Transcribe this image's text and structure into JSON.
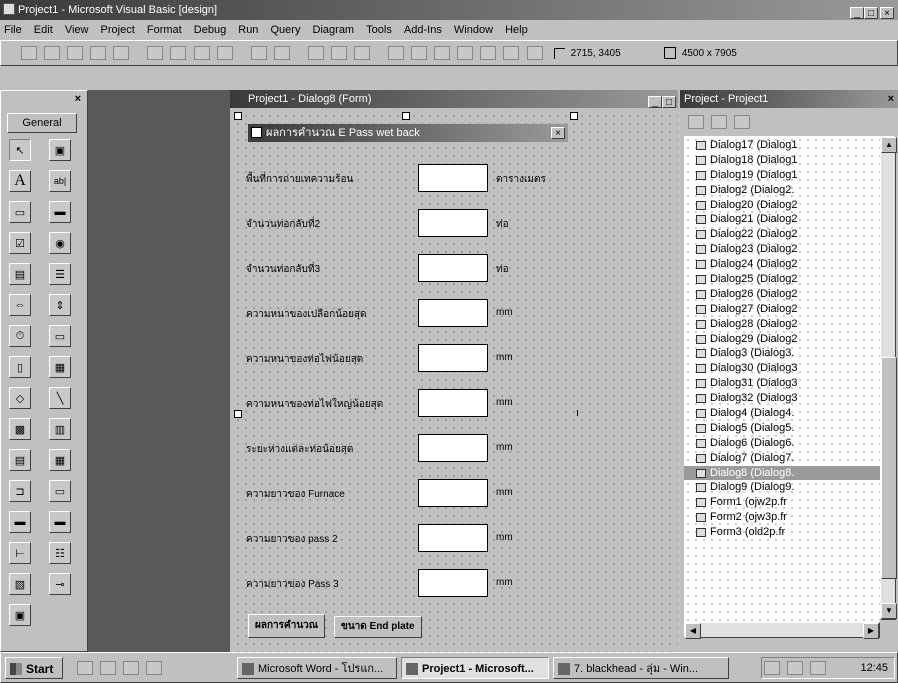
{
  "main_window": {
    "title": "Project1 - Microsoft Visual Basic [design]",
    "controls": [
      "_",
      "□",
      "×"
    ]
  },
  "menu": [
    "File",
    "Edit",
    "View",
    "Project",
    "Format",
    "Debug",
    "Run",
    "Query",
    "Diagram",
    "Tools",
    "Add-Ins",
    "Window",
    "Help"
  ],
  "toolbar": {
    "position": "2715, 3405",
    "size": "4500 x 7905"
  },
  "toolbox": {
    "title": "General",
    "close": "×"
  },
  "form_window": {
    "title": "Project1 - Dialog8 (Form)"
  },
  "dialog": {
    "title": "ผลการคำนวณ E Pass wet back",
    "close": "×",
    "rows": [
      {
        "label": "พื้นที่การถ่ายเทความร้อน",
        "unit": "ตารางเมตร"
      },
      {
        "label": "จำนวนท่อกลับที่2",
        "unit": "ท่อ"
      },
      {
        "label": "จำนวนท่อกลับที่3",
        "unit": "ท่อ"
      },
      {
        "label": "ความหนาของเปลือกน้อยสุด",
        "unit": "mm"
      },
      {
        "label": "ความหนาของท่อไฟน้อยสุด",
        "unit": "mm"
      },
      {
        "label": "ความหนาของท่อไฟใหญ่น้อยสุด",
        "unit": "mm"
      },
      {
        "label": "ระยะห่างแต่ละท่อน้อยสุด",
        "unit": "mm"
      },
      {
        "label": "ความยาวของ Furnace",
        "unit": "mm"
      },
      {
        "label": "ความยาวของ pass 2",
        "unit": "mm"
      },
      {
        "label": "ความยาวของ Pass 3",
        "unit": "mm"
      }
    ],
    "tabs": [
      "ผลการคำนวณ",
      "ขนาด End plate"
    ]
  },
  "project_panel": {
    "title": "Project - Project1",
    "close": "×",
    "items": [
      "Dialog17 (Dialog1",
      "Dialog18 (Dialog1",
      "Dialog19 (Dialog1",
      "Dialog2 (Dialog2.",
      "Dialog20 (Dialog2",
      "Dialog21 (Dialog2",
      "Dialog22 (Dialog2",
      "Dialog23 (Dialog2",
      "Dialog24 (Dialog2",
      "Dialog25 (Dialog2",
      "Dialog26 (Dialog2",
      "Dialog27 (Dialog2",
      "Dialog28 (Dialog2",
      "Dialog29 (Dialog2",
      "Dialog3 (Dialog3.",
      "Dialog30 (Dialog3",
      "Dialog31 (Dialog3",
      "Dialog32 (Dialog3",
      "Dialog4 (Dialog4.",
      "Dialog5 (Dialog5.",
      "Dialog6 (Dialog6.",
      "Dialog7 (Dialog7.",
      "Dialog8 (Dialog8.",
      "Dialog9 (Dialog9.",
      "Form1 (ojw2p.fr",
      "Form2 (ojw3p.fr",
      "Form3 (old2p.fr"
    ],
    "selected_index": 22
  },
  "taskbar": {
    "start": "Start",
    "tasks": [
      "Microsoft Word - โปรแก...",
      "Project1 - Microsoft...",
      "7. blackhead - ลุ่ม - Win..."
    ],
    "clock": "12:45"
  }
}
